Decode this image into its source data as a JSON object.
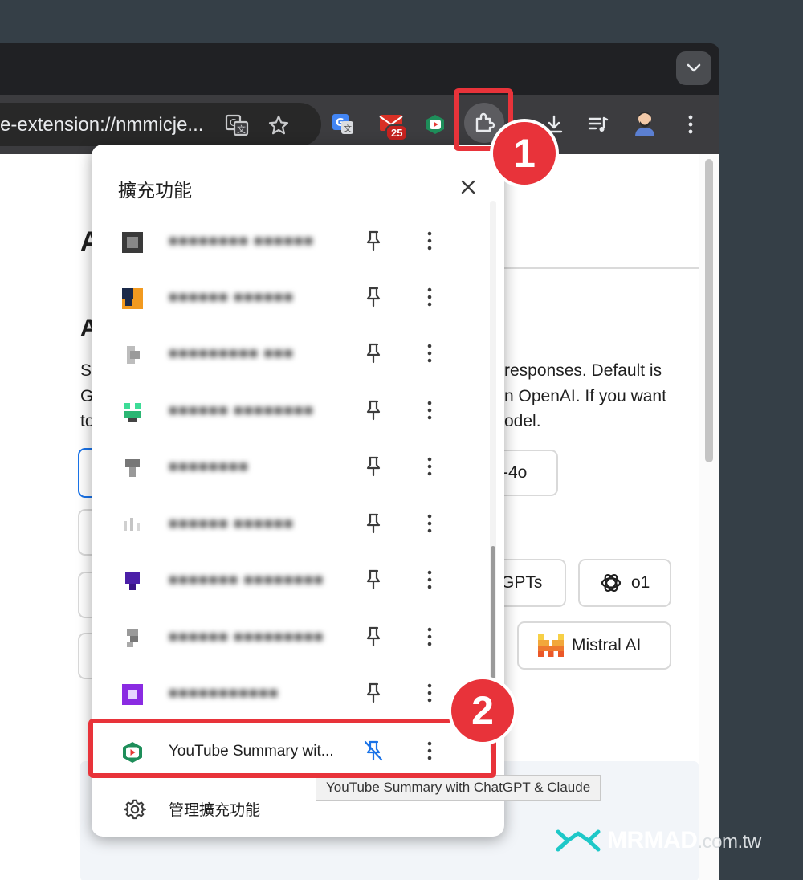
{
  "toolbar": {
    "url_text": "e-extension://nmmicje...",
    "mail_badge_count": "25"
  },
  "page": {
    "heading_a1": "A",
    "heading_a2": "A",
    "text_line1": "responses. Default is",
    "text_line2": "n OpenAI. If you want",
    "text_line3": "odel.",
    "text_prefix1": "S",
    "text_prefix2": "G",
    "text_prefix3": "to",
    "model_buttons": {
      "gpt4o_label": "-4o",
      "gpts_label": "GPTs",
      "o1_label": "o1",
      "mistral_label": "Mistral AI"
    }
  },
  "popup": {
    "title": "擴充功能",
    "extensions": [
      {
        "name": "■■■■■■■■ ■■■■■■"
      },
      {
        "name": "■■■■■■ ■■■■■■"
      },
      {
        "name": "■■■■■■■■■ ■■■"
      },
      {
        "name": "■■■■■■ ■■■■■■■■"
      },
      {
        "name": "■■■■■■■■"
      },
      {
        "name": "■■■■■■ ■■■■■■"
      },
      {
        "name": "■■■■■■■ ■■■■■■■■"
      },
      {
        "name": "■■■■■■ ■■■■■■■■■"
      },
      {
        "name": "■■■■■■■■■■■"
      },
      {
        "name": "YouTube Summary wit..."
      }
    ],
    "manage_label": "管理擴充功能"
  },
  "tooltip": "YouTube Summary with ChatGPT & Claude",
  "annotations": {
    "step1": "1",
    "step2": "2"
  },
  "watermark": {
    "brand": "MRMAD",
    "suffix": ".com.tw"
  },
  "colors": {
    "annotation_red": "#e8333a",
    "pin_active_blue": "#1a73e8",
    "youtube_green": "#1e8e5a"
  }
}
